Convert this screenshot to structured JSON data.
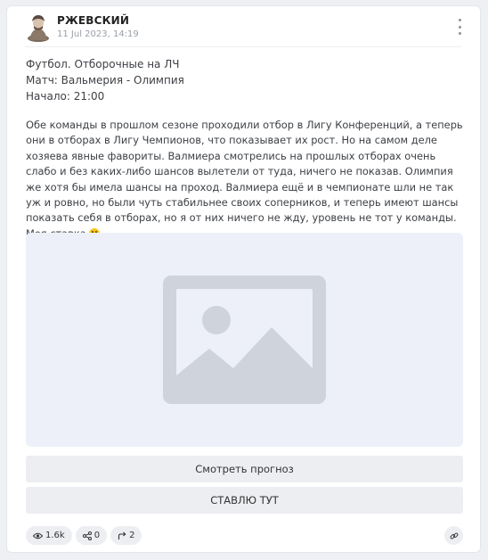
{
  "post": {
    "author": "РЖЕВСКИЙ",
    "date": "11 Jul 2023, 14:19",
    "meta": {
      "sport_line": "Футбол. Отборочные на ЛЧ",
      "match_line": "Матч: Вальмерия - Олимпия",
      "start_line": "Начало: 21:00"
    },
    "body": "Обе команды в прошлом сезоне проходили отбор в Лигу Конференций, а теперь они в отборах в Лигу Чемпионов, что показывает их рост. Но на самом деле хозяева явные фавориты. Валмиера смотрелись на прошлых отборах очень слабо и без каких-либо шансов вылетели от туда, ничего не показав. Олимпия же хотя бы имела шансы на проход. Валмиера ещё и в чемпионате шли не так уж и ровно, но были чуть стабильнее своих соперников, и теперь имеют шансы показать себя в отборах, но я от них ничего не жду, уровень не тот у команды. Моя ставка",
    "image_placeholder_icon": "image-placeholder-icon",
    "buttons": {
      "view_forecast": "Смотреть прогноз",
      "bet_here": "СТАВЛЮ ТУТ"
    },
    "stats": {
      "views": "1.6k",
      "shares": "0",
      "reposts": "2"
    }
  },
  "colors": {
    "background": "#eef0f4",
    "card": "#ffffff",
    "button": "#eceef2",
    "placeholder_bg": "#edf0f8",
    "placeholder_icon": "#cfd3dc"
  }
}
